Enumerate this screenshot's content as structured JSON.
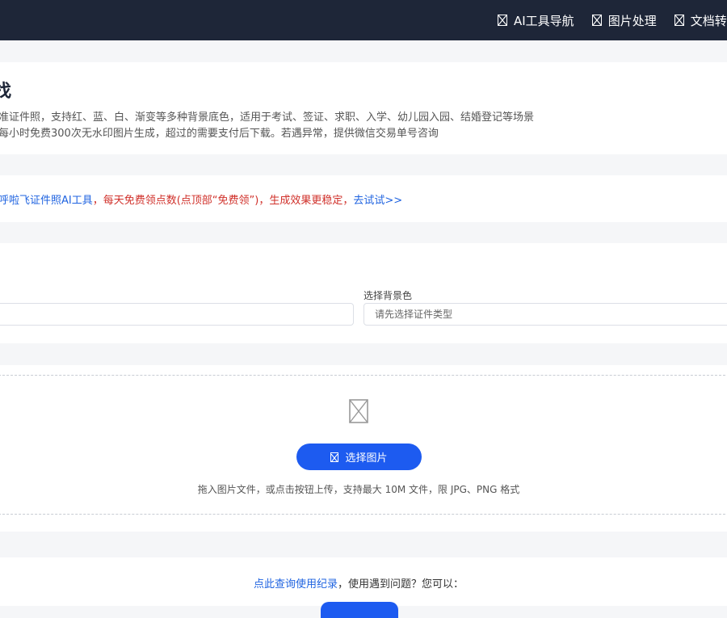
{
  "nav": {
    "items": [
      {
        "label": "AI工具导航"
      },
      {
        "label": "图片处理"
      },
      {
        "label": "文档转"
      }
    ]
  },
  "intro": {
    "title": "找",
    "desc_line1": "准证件照，支持红、蓝、白、渐变等多种背景底色，适用于考试、签证、求职、入学、幼儿园入园、结婚登记等场景",
    "desc_line2": "每小时免费300次无水印图片生成，超过的需要支付后下载。若遇异常，提供微信交易单号咨询"
  },
  "notice": {
    "blue_text": "呼啦飞证件照AI工具",
    "red_text": "，每天免费领点数(点顶部“免费领”)，生成效果更稳定，",
    "link_text": "去试试>>"
  },
  "form": {
    "bg_label": "选择背景色",
    "bg_placeholder": "请先选择证件类型",
    "type_value": ""
  },
  "upload": {
    "button_label": "选择图片",
    "hint": "拖入图片文件，或点击按钮上传，支持最大 10M 文件，限 JPG、PNG 格式"
  },
  "records": {
    "link_text": "点此查询使用纪录",
    "text": "，使用遇到问题？您可以："
  },
  "colors": {
    "topbar": "#1e2638",
    "accent": "#1d5bf0",
    "link": "#1f63e0",
    "warning": "#d0302a"
  },
  "icons": {
    "nav": "image-placeholder-icon",
    "upload": "image-placeholder-icon"
  }
}
